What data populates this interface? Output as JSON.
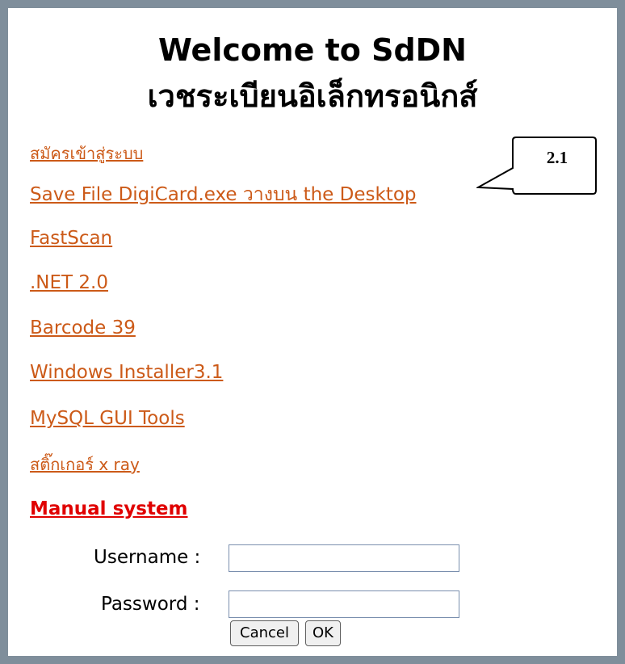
{
  "header": {
    "title_en": "Welcome to SdDN",
    "title_th": "เวชระเบียนอิเล็กทรอนิกส์"
  },
  "links": [
    {
      "label": "สมัครเข้าสู่ระบบ"
    },
    {
      "label": "Save File DigiCard.exe วางบน the Desktop"
    },
    {
      "label": "FastScan"
    },
    {
      "label": ".NET 2.0"
    },
    {
      "label": "Barcode 39"
    },
    {
      "label": "Windows Installer3.1"
    },
    {
      "label": "MySQL GUI Tools"
    },
    {
      "label": "สติ๊กเกอร์ x ray"
    },
    {
      "label": "Manual system"
    }
  ],
  "callout": {
    "label": "2.1"
  },
  "login": {
    "username_label": "Username :",
    "username_value": "",
    "password_label": "Password :",
    "password_value": "",
    "cancel_label": "Cancel",
    "ok_label": "OK"
  },
  "colors": {
    "frame": "#7f8e9b",
    "link": "#cc5a18",
    "manual_link": "#e00000"
  }
}
